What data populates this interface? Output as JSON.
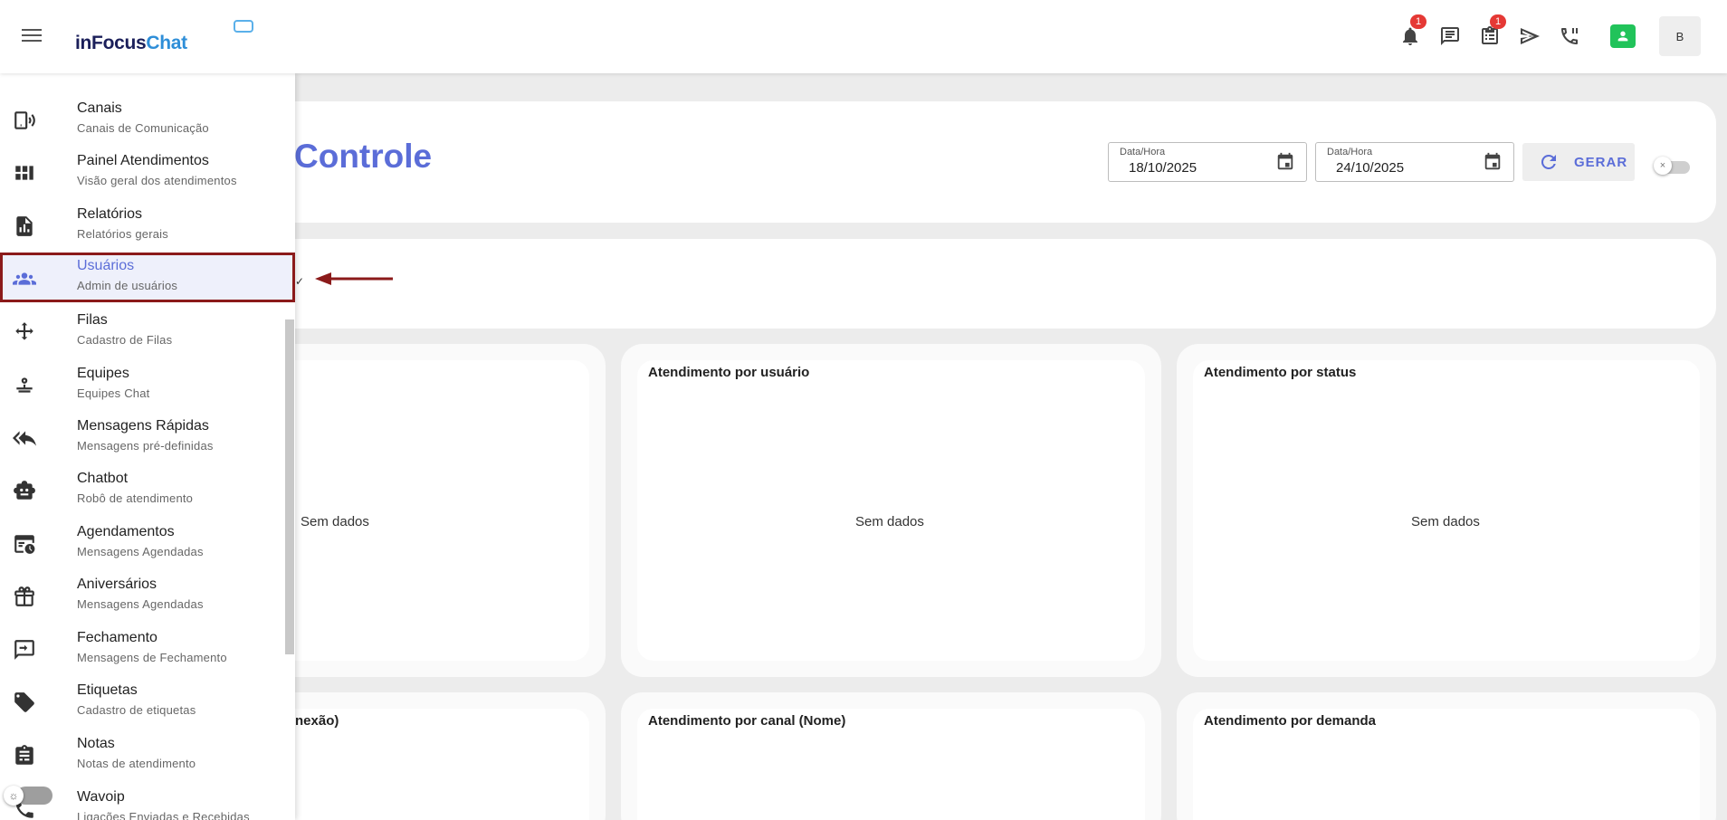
{
  "header": {
    "logo_part1": "inFocus",
    "logo_part2": "Chat",
    "notifications_badge": "1",
    "tasks_badge": "1",
    "avatar_initial": "B"
  },
  "sidebar": {
    "items": [
      {
        "label": "Canais",
        "sub": "Canais de Comunicação",
        "icon": "channels-icon"
      },
      {
        "label": "Painel Atendimentos",
        "sub": "Visão geral dos atendimentos",
        "icon": "dashboard-icon"
      },
      {
        "label": "Relatórios",
        "sub": "Relatórios gerais",
        "icon": "report-icon"
      },
      {
        "label": "Usuários",
        "sub": "Admin de usuários",
        "icon": "users-icon"
      },
      {
        "label": "Filas",
        "sub": "Cadastro de Filas",
        "icon": "queue-icon"
      },
      {
        "label": "Equipes",
        "sub": "Equipes Chat",
        "icon": "team-icon"
      },
      {
        "label": "Mensagens Rápidas",
        "sub": "Mensagens pré-definidas",
        "icon": "reply-all-icon"
      },
      {
        "label": "Chatbot",
        "sub": "Robô de atendimento",
        "icon": "robot-icon"
      },
      {
        "label": "Agendamentos",
        "sub": "Mensagens Agendadas",
        "icon": "schedule-icon"
      },
      {
        "label": "Aniversários",
        "sub": "Mensagens Agendadas",
        "icon": "gift-icon"
      },
      {
        "label": "Fechamento",
        "sub": "Mensagens de Fechamento",
        "icon": "close-message-icon"
      },
      {
        "label": "Etiquetas",
        "sub": "Cadastro de etiquetas",
        "icon": "tag-icon"
      },
      {
        "label": "Notas",
        "sub": "Notas de atendimento",
        "icon": "notes-icon"
      },
      {
        "label": "Wavoip",
        "sub": "Ligações Enviadas e Recebidas",
        "icon": "phone-icon"
      }
    ]
  },
  "main": {
    "title": "Controle",
    "date_from": {
      "label": "Data/Hora",
      "value": "18/10/2025"
    },
    "date_to": {
      "label": "Data/Hora",
      "value": "24/10/2025"
    },
    "generate_label": "GERAR",
    "charts": [
      {
        "title": "",
        "nodata": "Sem dados"
      },
      {
        "title": "Atendimento por usuário",
        "nodata": "Sem dados"
      },
      {
        "title": "Atendimento por status",
        "nodata": "Sem dados"
      },
      {
        "title": "nexão)",
        "nodata": ""
      },
      {
        "title": "Atendimento por canal (Nome)",
        "nodata": ""
      },
      {
        "title": "Atendimento por demanda",
        "nodata": ""
      }
    ]
  }
}
